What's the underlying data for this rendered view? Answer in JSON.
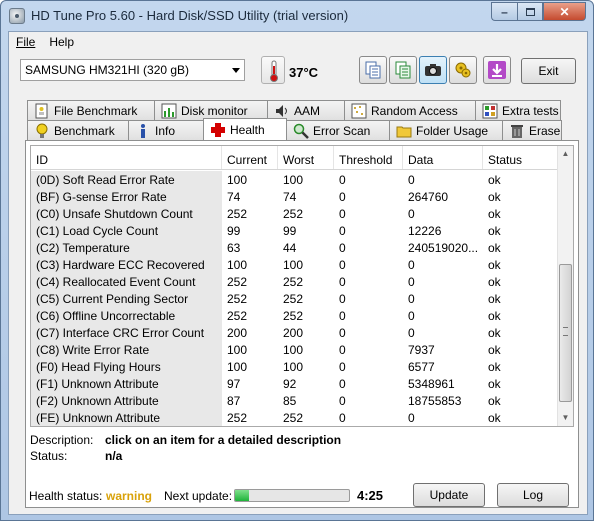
{
  "window": {
    "title": "HD Tune Pro 5.60 - Hard Disk/SSD Utility (trial version)"
  },
  "menu": {
    "file": "File",
    "help": "Help"
  },
  "toolbar": {
    "drive": "SAMSUNG HM321HI (320 gB)",
    "temperature": "37°C",
    "exit_label": "Exit"
  },
  "tabs_top": [
    "File Benchmark",
    "Disk monitor",
    "AAM",
    "Random Access",
    "Extra tests"
  ],
  "tabs_bottom": [
    "Benchmark",
    "Info",
    "Health",
    "Error Scan",
    "Folder Usage",
    "Erase"
  ],
  "active_tab": "Health",
  "table": {
    "headers": {
      "id": "ID",
      "current": "Current",
      "worst": "Worst",
      "threshold": "Threshold",
      "data": "Data",
      "status": "Status"
    },
    "rows": [
      {
        "id": "(0D) Soft Read Error Rate",
        "current": "100",
        "worst": "100",
        "threshold": "0",
        "data": "0",
        "status": "ok"
      },
      {
        "id": "(BF) G-sense Error Rate",
        "current": "74",
        "worst": "74",
        "threshold": "0",
        "data": "264760",
        "status": "ok"
      },
      {
        "id": "(C0) Unsafe Shutdown Count",
        "current": "252",
        "worst": "252",
        "threshold": "0",
        "data": "0",
        "status": "ok"
      },
      {
        "id": "(C1) Load Cycle Count",
        "current": "99",
        "worst": "99",
        "threshold": "0",
        "data": "12226",
        "status": "ok"
      },
      {
        "id": "(C2) Temperature",
        "current": "63",
        "worst": "44",
        "threshold": "0",
        "data": "240519020...",
        "status": "ok"
      },
      {
        "id": "(C3) Hardware ECC Recovered",
        "current": "100",
        "worst": "100",
        "threshold": "0",
        "data": "0",
        "status": "ok"
      },
      {
        "id": "(C4) Reallocated Event Count",
        "current": "252",
        "worst": "252",
        "threshold": "0",
        "data": "0",
        "status": "ok"
      },
      {
        "id": "(C5) Current Pending Sector",
        "current": "252",
        "worst": "252",
        "threshold": "0",
        "data": "0",
        "status": "ok"
      },
      {
        "id": "(C6) Offline Uncorrectable",
        "current": "252",
        "worst": "252",
        "threshold": "0",
        "data": "0",
        "status": "ok"
      },
      {
        "id": "(C7) Interface CRC Error Count",
        "current": "200",
        "worst": "200",
        "threshold": "0",
        "data": "0",
        "status": "ok"
      },
      {
        "id": "(C8) Write Error Rate",
        "current": "100",
        "worst": "100",
        "threshold": "0",
        "data": "7937",
        "status": "ok"
      },
      {
        "id": "(F0) Head Flying Hours",
        "current": "100",
        "worst": "100",
        "threshold": "0",
        "data": "6577",
        "status": "ok"
      },
      {
        "id": "(F1) Unknown Attribute",
        "current": "97",
        "worst": "92",
        "threshold": "0",
        "data": "5348961",
        "status": "ok"
      },
      {
        "id": "(F2) Unknown Attribute",
        "current": "87",
        "worst": "85",
        "threshold": "0",
        "data": "18755853",
        "status": "ok"
      },
      {
        "id": "(FE) Unknown Attribute",
        "current": "252",
        "worst": "252",
        "threshold": "0",
        "data": "0",
        "status": "ok"
      }
    ]
  },
  "description": {
    "description_label": "Description:",
    "description_value": "click on an item for a detailed description",
    "status_label": "Status:",
    "status_value": "n/a"
  },
  "footer": {
    "health_label": "Health status:",
    "health_value": "warning",
    "next_update_label": "Next update:",
    "next_update_progress": 0.12,
    "timer": "4:25",
    "update_label": "Update",
    "log_label": "Log"
  },
  "colors": {
    "warning": "#d9a20a",
    "progress": "#1fb33a",
    "health_tab_icon": "#d40000"
  }
}
